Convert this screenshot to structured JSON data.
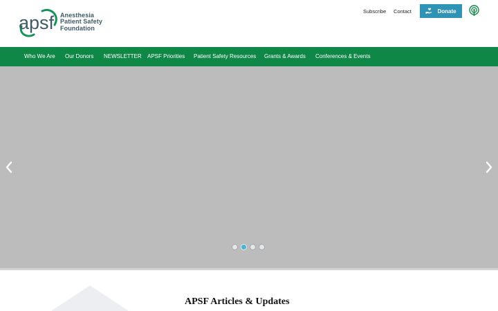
{
  "logo": {
    "mark_text": "apsf",
    "line1": "Anesthesia",
    "line2": "Patient Safety",
    "line3": "Foundation",
    "brand_color": "#3d5a66",
    "accent_color": "#12935a"
  },
  "header": {
    "subscribe_label": "Subscribe",
    "contact_label": "Contact",
    "donate_label": "Donate",
    "donate_icon": "hand-heart-icon",
    "podcast_icon": "podcast-icon",
    "donate_color": "#2f93b5"
  },
  "nav": {
    "color": "#0f8747",
    "items": [
      {
        "label": "Who We Are"
      },
      {
        "label": "Our Donors"
      },
      {
        "label": "NEWSLETTER"
      },
      {
        "label": "APSF Priorities"
      },
      {
        "label": "Patient Safety Resources"
      },
      {
        "label": "Grants & Awards"
      },
      {
        "label": "Conferences & Events"
      }
    ]
  },
  "carousel": {
    "background": "#bcbcbc",
    "prev_icon": "chevron-left-icon",
    "next_icon": "chevron-right-icon",
    "slide_count": 4,
    "active_slide": 2
  },
  "main": {
    "section_title": "APSF Articles & Updates"
  }
}
